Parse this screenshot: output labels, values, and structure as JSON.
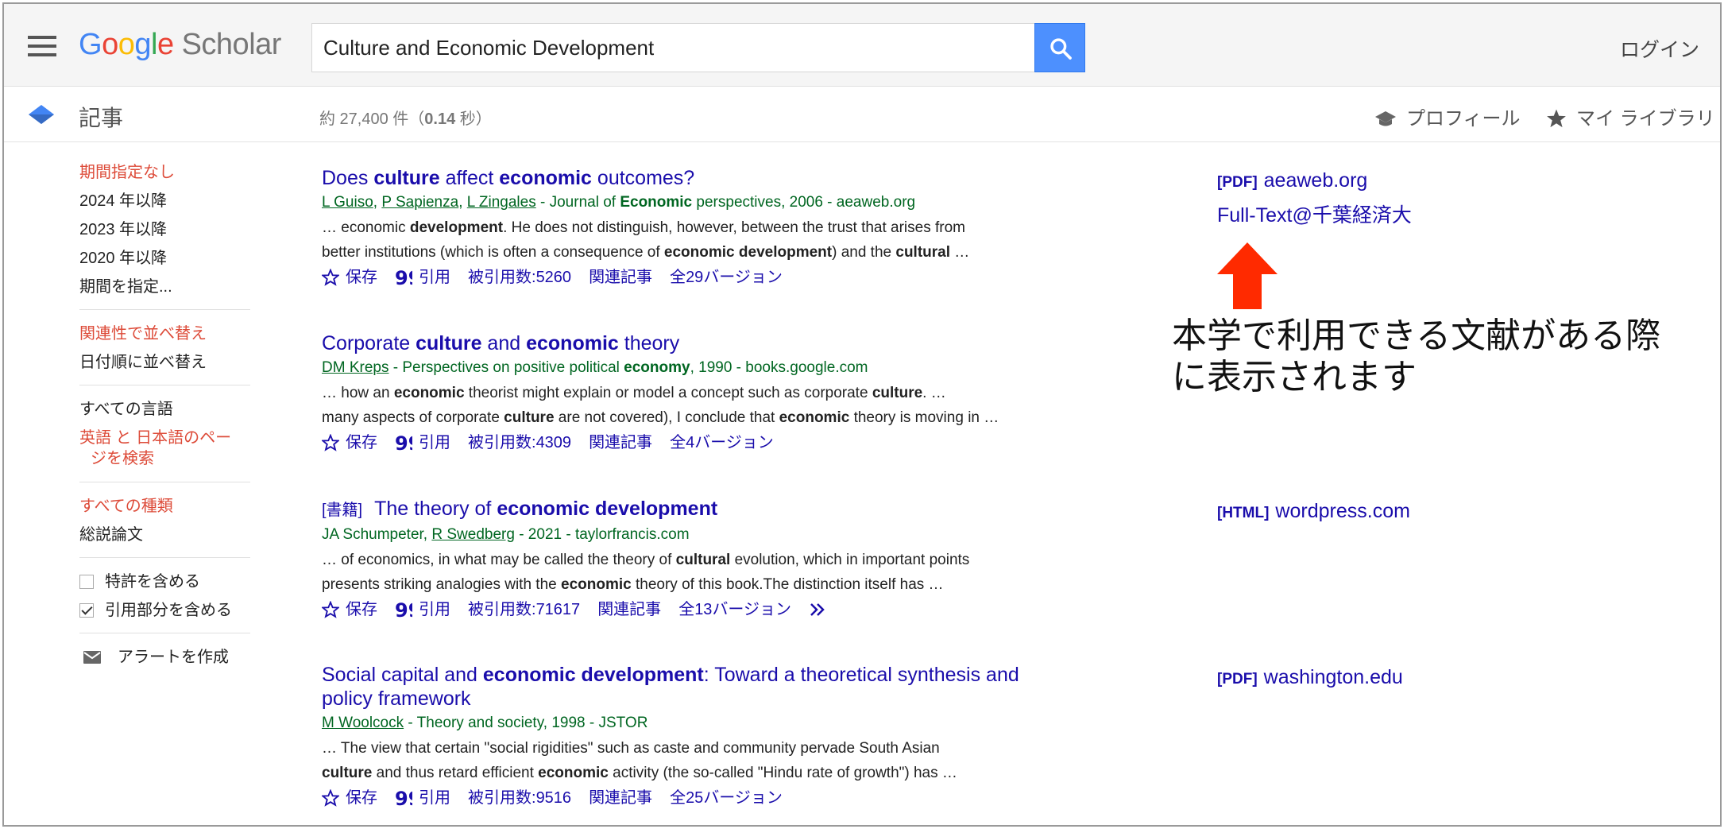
{
  "header": {
    "logo_google": [
      "G",
      "o",
      "o",
      "g",
      "l",
      "e"
    ],
    "logo_scholar": "Scholar",
    "search_value": "Culture and Economic Development",
    "login": "ログイン"
  },
  "subheader": {
    "title": "記事",
    "result_count_prefix": "約 27,400 件（",
    "result_count_time": "0.14",
    "result_count_suffix": " 秒）",
    "profile": "プロフィール",
    "library": "マイ ライブラリ"
  },
  "sidebar": {
    "time_items": [
      "期間指定なし",
      "2024 年以降",
      "2023 年以降",
      "2020 年以降",
      "期間を指定..."
    ],
    "sort_items": [
      "関連性で並べ替え",
      "日付順に並べ替え"
    ],
    "lang_all": "すべての言語",
    "lang_search_line1": "英語 と 日本語のペー",
    "lang_search_line2": "ジを検索",
    "type_items": [
      "すべての種類",
      "総説論文"
    ],
    "include_patents": "特許を含める",
    "include_citations": "引用部分を含める",
    "create_alert": "アラートを作成"
  },
  "actions": {
    "save": "保存",
    "cite": "引用",
    "cited_by_prefix": "被引用数: ",
    "related": "関連記事",
    "versions_prefix": "全 ",
    "versions_suffix": " バージョン"
  },
  "results": [
    {
      "title_parts": [
        "Does ",
        "culture",
        " affect ",
        "economic",
        " outcomes?"
      ],
      "authors": [
        "L Guiso",
        "P Sapienza",
        "L Zingales"
      ],
      "meta_a": " - Journal of ",
      "meta_bold": "Economic",
      "meta_b": " perspectives, 2006 - aeaweb.org",
      "snippet1": [
        "… economic ",
        "development",
        ". He does not distinguish, however, between the trust that arises from"
      ],
      "snippet2": [
        "better institutions (which is often a consequence of ",
        "economic development",
        ") and the ",
        "cultural",
        " …"
      ],
      "cited_by": "5260",
      "versions": "29",
      "side_tag": "[PDF]",
      "side_domain": "aeaweb.org",
      "side_extra": "Full-Text@千葉経済大"
    },
    {
      "title_parts": [
        "Corporate ",
        "culture",
        " and ",
        "economic",
        " theory"
      ],
      "authors": [
        "DM Kreps"
      ],
      "meta_a": " - Perspectives on positive political ",
      "meta_bold": "economy",
      "meta_b": ", 1990 - books.google.com",
      "snippet1": [
        "… how an ",
        "economic",
        " theorist might explain or model a concept such as corporate ",
        "culture",
        ". …"
      ],
      "snippet2": [
        "many aspects of corporate ",
        "culture",
        " are not covered), I conclude that ",
        "economic",
        " theory is moving in …"
      ],
      "cited_by": "4309",
      "versions": "4"
    },
    {
      "type": "[書籍]",
      "title_parts": [
        " The theory of ",
        "economic development"
      ],
      "author_plain": "JA Schumpeter, ",
      "authors": [
        "R Swedberg"
      ],
      "meta_b": " - 2021 - taylorfrancis.com",
      "snippet1": [
        "… of economics, in what may be called the theory of ",
        "cultural",
        " evolution, which in important points"
      ],
      "snippet2": [
        "presents striking analogies with the ",
        "economic",
        " theory of this book.The distinction itself has …"
      ],
      "cited_by": "71617",
      "versions": "13",
      "side_tag": "[HTML]",
      "side_domain": "wordpress.com"
    },
    {
      "title_parts": [
        "Social capital and ",
        "economic development",
        ": Toward a theoretical synthesis and"
      ],
      "title_line2": "policy framework",
      "authors": [
        "M Woolcock"
      ],
      "meta_b": " - Theory and society, 1998 - JSTOR",
      "snippet1": [
        "… The view that certain \"social rigidities\" such as caste and community pervade South Asian"
      ],
      "snippet2": [
        "culture",
        " and thus retard efficient ",
        "economic",
        " activity (the so-called \"Hindu rate of growth\") has …"
      ],
      "cited_by": "9516",
      "versions": "25",
      "side_tag": "[PDF]",
      "side_domain": "washington.edu"
    }
  ],
  "annotation": {
    "line1": "本学で利用できる文献がある際",
    "line2": "に表示されます",
    "arrow_color": "#ff2a00"
  }
}
